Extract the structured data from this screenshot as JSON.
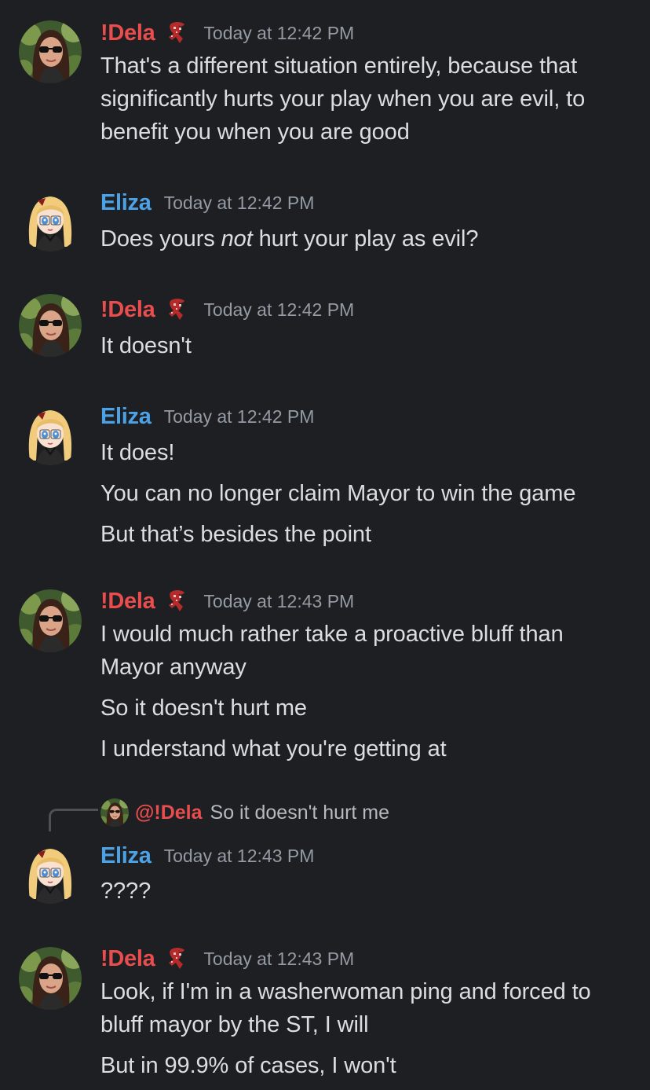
{
  "users": {
    "dela": {
      "name": "!Dela",
      "color": "#ea4d4d"
    },
    "eliza": {
      "name": "Eliza",
      "color": "#4ca2e6"
    }
  },
  "messages": [
    {
      "author": "!Dela",
      "timestamp": "Today at 12:42 PM",
      "lines": [
        "That's a different situation entirely, because that",
        "significantly hurts your play when you are evil, to",
        "benefit you when you are good"
      ]
    },
    {
      "author": "Eliza",
      "timestamp": "Today at 12:42 PM",
      "lines": [
        {
          "pre": "Does yours ",
          "em": "not",
          "post": " hurt your play as evil?"
        }
      ]
    },
    {
      "author": "!Dela",
      "timestamp": "Today at 12:42 PM",
      "lines": [
        "It doesn't"
      ]
    },
    {
      "author": "Eliza",
      "timestamp": "Today at 12:42 PM",
      "lines": [
        "It does!",
        "You can no longer claim Mayor to win the game",
        "But that’s besides the point"
      ]
    },
    {
      "author": "!Dela",
      "timestamp": "Today at 12:43 PM",
      "lines": [
        "I would much rather take a proactive bluff than",
        "Mayor anyway",
        "So it doesn't hurt me",
        "I understand what you're getting at"
      ]
    },
    {
      "author": "Eliza",
      "timestamp": "Today at 12:43 PM",
      "reply": {
        "mention": "@!Dela",
        "text": "So it doesn't hurt me"
      },
      "lines": [
        "????"
      ]
    },
    {
      "author": "!Dela",
      "timestamp": "Today at 12:43 PM",
      "lines": [
        "Look, if I'm in a washerwoman ping and forced to",
        "bluff mayor by the ST, I will",
        "But in 99.9% of cases, I won't"
      ]
    }
  ]
}
